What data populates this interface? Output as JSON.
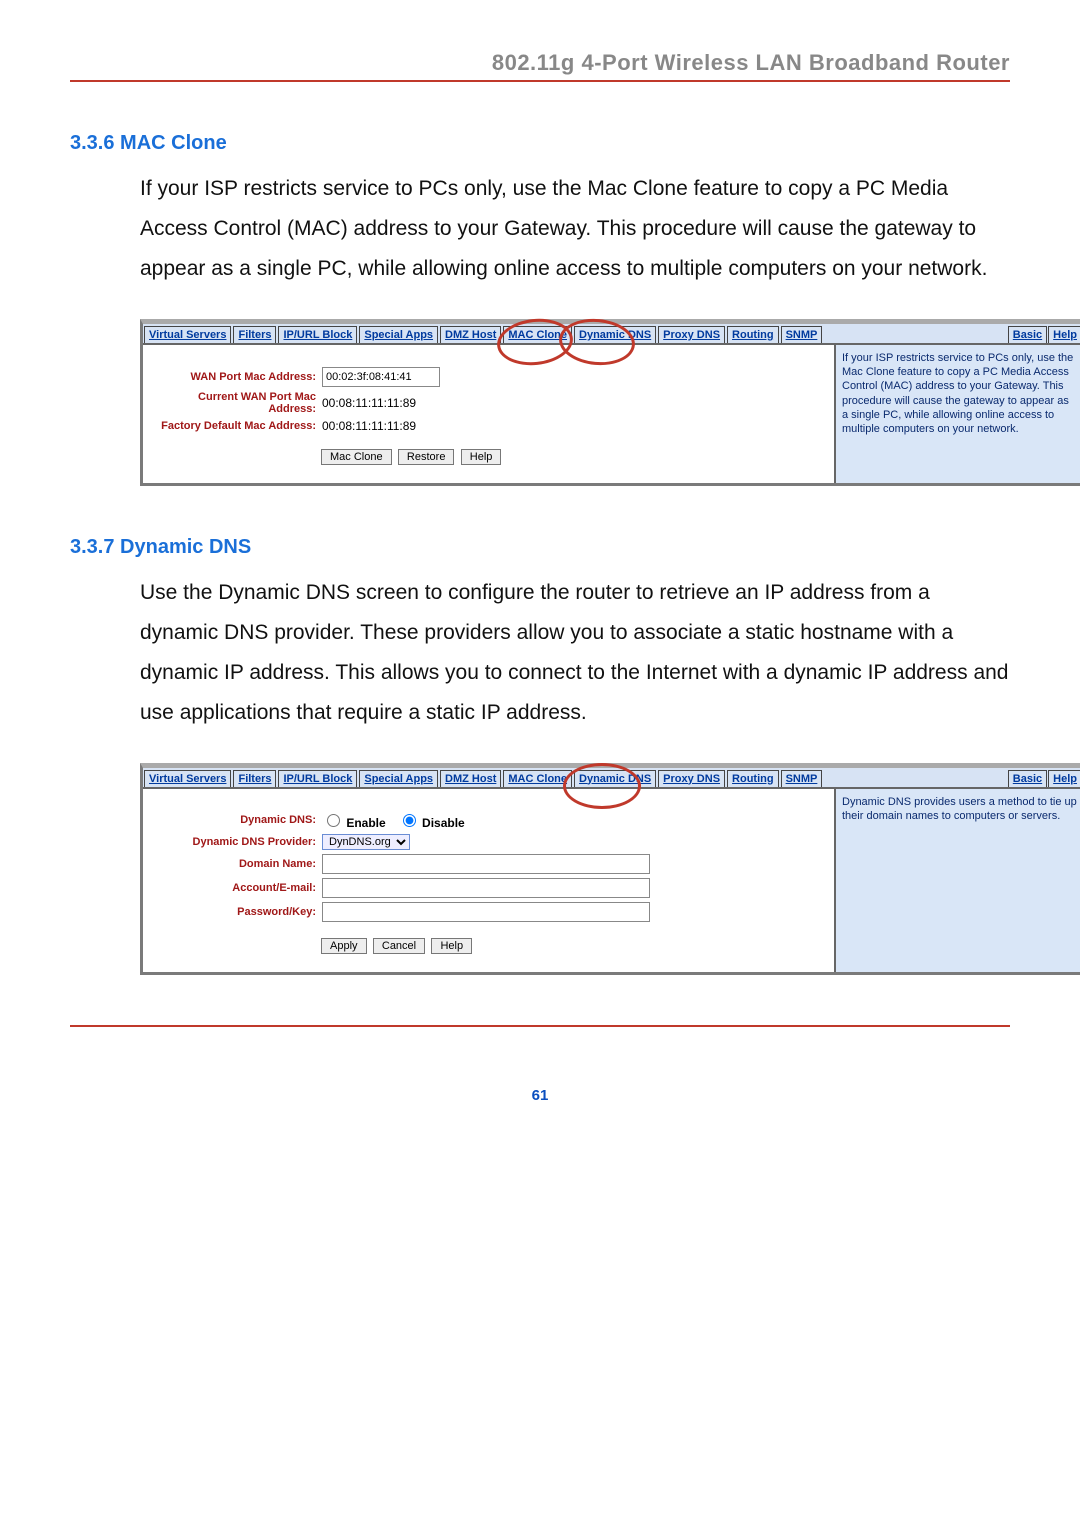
{
  "header": "802.11g 4-Port Wireless LAN Broadband Router",
  "sec1": {
    "title": "3.3.6 MAC Clone",
    "body": "If your ISP restricts service to PCs only, use the Mac Clone feature to copy a PC Media Access Control (MAC) address to your Gateway. This procedure will cause the gateway to appear as a single PC, while   allowing online access to multiple computers on your network."
  },
  "sec2": {
    "title": "3.3.7 Dynamic DNS",
    "body": "Use the Dynamic DNS screen to configure the router to retrieve an IP address from a dynamic DNS provider. These providers allow you to associate a static hostname with a dynamic IP address. This allows you to connect to the Internet with a dynamic IP address and use applications that require a static IP address."
  },
  "tabs": [
    "Virtual Servers",
    "Filters",
    "IP/URL Block",
    "Special Apps",
    "DMZ Host",
    "MAC Clone",
    "Dynamic DNS",
    "Proxy DNS",
    "Routing",
    "SNMP"
  ],
  "tabs_right": [
    "Basic",
    "Help"
  ],
  "macclone": {
    "wan_label": "WAN Port Mac Address:",
    "wan_value": "00:02:3f:08:41:41",
    "cur_label": "Current WAN Port Mac Address:",
    "cur_value": "00:08:11:11:11:89",
    "fac_label": "Factory Default Mac Address:",
    "fac_value": "00:08:11:11:11:89",
    "btn_clone": "Mac Clone",
    "btn_restore": "Restore",
    "btn_help": "Help",
    "help": "If your ISP restricts service to PCs only, use the Mac Clone feature to copy a PC Media Access Control (MAC) address to your Gateway. This procedure will cause the gateway to appear as a single PC, while allowing online access to multiple computers on your network."
  },
  "ddns": {
    "row1_label": "Dynamic DNS:",
    "enable": "Enable",
    "disable": "Disable",
    "row2_label": "Dynamic DNS Provider:",
    "provider": "DynDNS.org",
    "row3_label": "Domain Name:",
    "row4_label": "Account/E-mail:",
    "row5_label": "Password/Key:",
    "btn_apply": "Apply",
    "btn_cancel": "Cancel",
    "btn_help": "Help",
    "help": "Dynamic DNS provides users a method to tie up their domain names to computers or servers."
  },
  "page_number": "61"
}
